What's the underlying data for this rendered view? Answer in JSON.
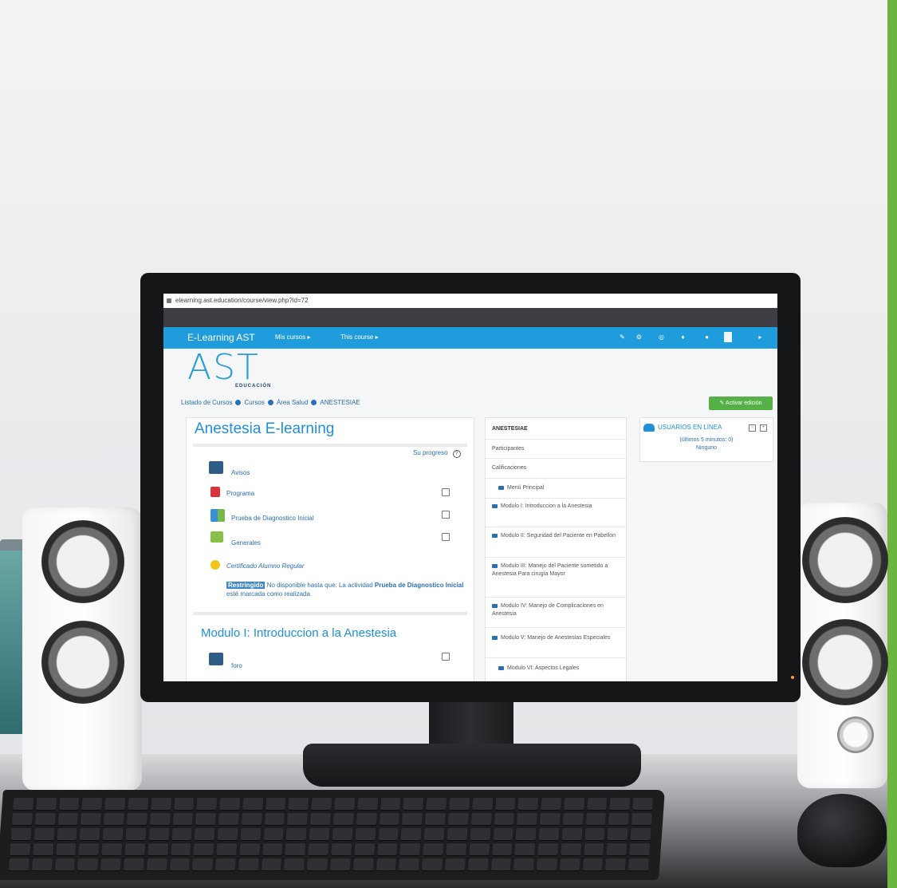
{
  "browser": {
    "url": "elearning.ast.education/course/view.php?id=72"
  },
  "navbar": {
    "brand": "E-Learning AST",
    "links": [
      "Mis cursos ▸",
      "This course ▸"
    ],
    "icons": [
      "edit-icon",
      "gear-icon",
      "globe-icon",
      "bell-icon",
      "chat-icon",
      "user-avatar",
      "caret-icon"
    ]
  },
  "logo": {
    "word": "AST",
    "sub": "EDUCACIÓN"
  },
  "breadcrumb": [
    "Listado de Cursos",
    "Cursos",
    "Área Salud",
    "ANESTESIAE"
  ],
  "edit_button": "Activar edición",
  "course": {
    "title": "Anestesia E-learning",
    "progress_label": "Su progreso",
    "activities": [
      {
        "label": "Avisos",
        "icon": "forum-icon",
        "check": false
      },
      {
        "label": "Programa",
        "icon": "pdf-icon",
        "check": true
      },
      {
        "label": "Prueba de Diagnostico Inicial",
        "icon": "quiz-icon",
        "check": true
      },
      {
        "label": "Generales",
        "icon": "book-icon",
        "check": true
      },
      {
        "label": "Certificado Alumno Regular",
        "icon": "certificate-icon",
        "check": false
      }
    ],
    "restriction": {
      "badge": "Restringido",
      "text1": "No disponible hasta que: La actividad ",
      "bold": "Prueba de Diagnostico Inicial",
      "text2": " esté marcada como realizada"
    },
    "module_title": "Modulo I: Introduccion a la Anestesia",
    "module_activity": "foro"
  },
  "sidebar": {
    "heading": "ANESTESIAE",
    "items": [
      "Participantes",
      "Calificaciones",
      "Menú Principal",
      "Modulo I: Introduccion a la Anestesia",
      "Modulo II: Seguridad del Paciente en Pabellon",
      "Modulo III: Manejo del Paciente sometido a Anestesia Para cirugía Mayor",
      "Modulo IV: Manejo de Complicaciones en Anestesia",
      "Modulo V: Manejo de Anestesias Especiales",
      "Modulo VI: Aspectos Legales"
    ]
  },
  "online_users": {
    "title": "USUARIOS EN LÍNEA",
    "subtitle": "(últimos 5 minutos: 0)",
    "value": "Ninguno"
  },
  "colors": {
    "accent": "#1f9cdc",
    "edit_button": "#55b046",
    "brand_green": "#6cb53f"
  }
}
